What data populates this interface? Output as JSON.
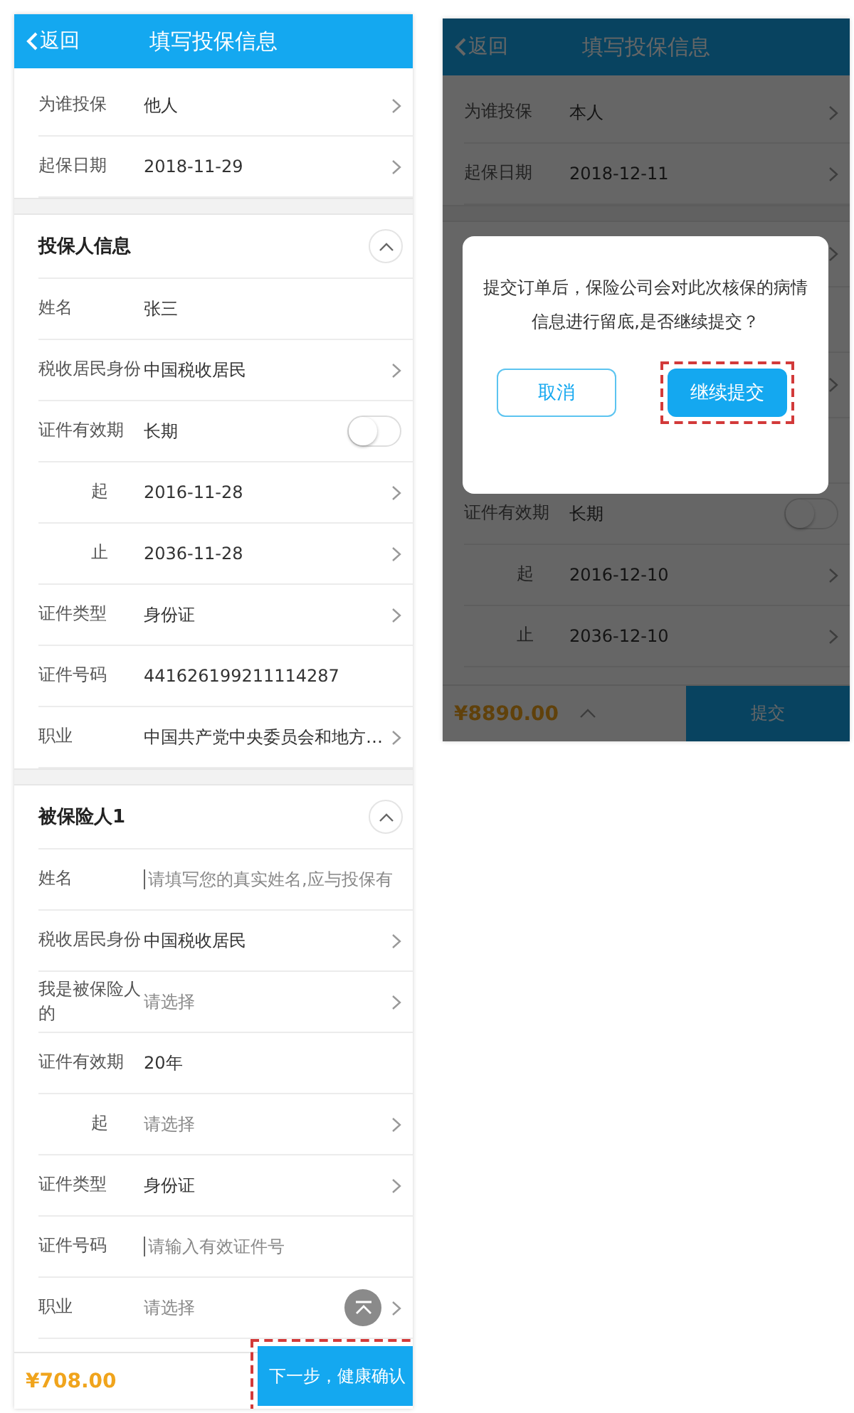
{
  "screens": [
    {
      "header": {
        "back": "返回",
        "title": "填写投保信息"
      },
      "sections": [
        {
          "rows": [
            {
              "kind": "select",
              "label": "为谁投保",
              "value": "他人"
            },
            {
              "kind": "select",
              "label": "起保日期",
              "value": "2018-11-29"
            }
          ]
        },
        {
          "title": "投保人信息",
          "expanded": true,
          "rows": [
            {
              "kind": "text",
              "label": "姓名",
              "value": "张三"
            },
            {
              "kind": "select",
              "label": "税收居民身份",
              "value": "中国税收居民"
            },
            {
              "kind": "toggle",
              "label": "证件有效期",
              "value": "长期",
              "on": false
            },
            {
              "kind": "select",
              "label": "起",
              "value": "2016-11-28",
              "indented": true
            },
            {
              "kind": "select",
              "label": "止",
              "value": "2036-11-28",
              "indented": true
            },
            {
              "kind": "select",
              "label": "证件类型",
              "value": "身份证"
            },
            {
              "kind": "text",
              "label": "证件号码",
              "value": "441626199211114287"
            },
            {
              "kind": "select",
              "label": "职业",
              "value": "中国共产党中央委员会和地方…"
            }
          ]
        },
        {
          "title": "被保险人1",
          "expanded": true,
          "rows": [
            {
              "kind": "input",
              "label": "姓名",
              "placeholder": "请填写您的真实姓名,应与投保有"
            },
            {
              "kind": "select",
              "label": "税收居民身份",
              "value": "中国税收居民"
            },
            {
              "kind": "select",
              "label": "我是被保险人的",
              "placeholder": "请选择"
            },
            {
              "kind": "text",
              "label": "证件有效期",
              "value": "20年"
            },
            {
              "kind": "select",
              "label": "起",
              "placeholder": "请选择",
              "indented": true
            },
            {
              "kind": "select",
              "label": "证件类型",
              "value": "身份证"
            },
            {
              "kind": "input",
              "label": "证件号码",
              "placeholder": "请输入有效证件号"
            },
            {
              "kind": "select",
              "label": "职业",
              "placeholder": "请选择"
            }
          ]
        }
      ],
      "back_to_top": true,
      "footer": {
        "price": "¥708.00",
        "button": "下一步，健康确认",
        "highlighted": true
      }
    },
    {
      "header": {
        "back": "返回",
        "title": "填写投保信息"
      },
      "sections": [
        {
          "rows": [
            {
              "kind": "select",
              "label": "为谁投保",
              "value": "本人"
            },
            {
              "kind": "select",
              "label": "起保日期",
              "value": "2018-12-11"
            }
          ]
        },
        {
          "rows": [
            {
              "kind": "blank",
              "chevron": true
            },
            {
              "kind": "blank",
              "chevron": false
            },
            {
              "kind": "blank",
              "chevron": true
            },
            {
              "kind": "blank",
              "chevron": false
            },
            {
              "kind": "toggle",
              "label": "证件有效期",
              "value": "长期",
              "on": false
            },
            {
              "kind": "select",
              "label": "起",
              "value": "2016-12-10",
              "indented": true
            },
            {
              "kind": "select",
              "label": "止",
              "value": "2036-12-10",
              "indented": true
            }
          ]
        }
      ],
      "footer": {
        "price": "¥8890.00",
        "expand": true,
        "button": "提交"
      },
      "dialog": {
        "message": "提交订单后，保险公司会对此次核保的病情信息进行留底,是否继续提交？",
        "buttons": [
          {
            "label": "取消",
            "kind": "secondary"
          },
          {
            "label": "继续提交",
            "kind": "primary",
            "highlighted": true
          }
        ]
      }
    }
  ]
}
